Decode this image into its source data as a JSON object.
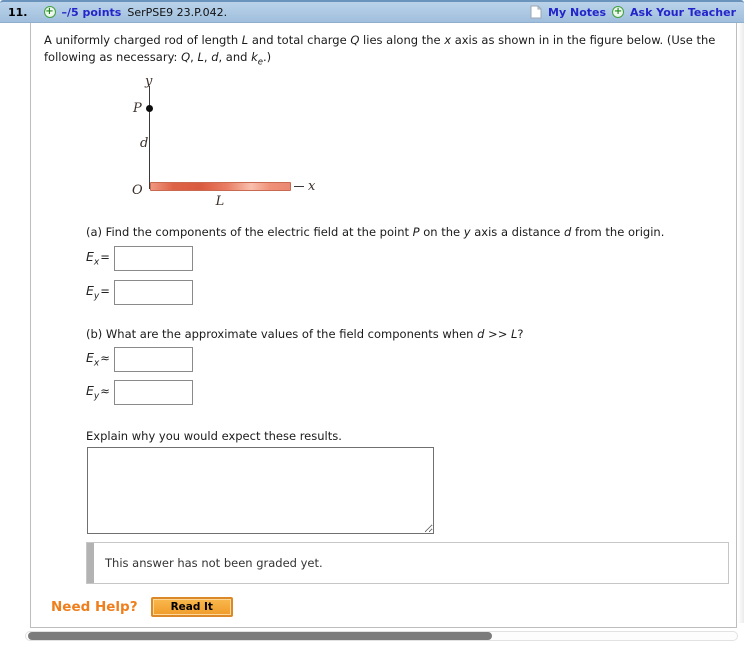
{
  "header": {
    "question_number": "11.",
    "points_label": "–/5 points",
    "assignment_id": "SerPSE9 23.P.042.",
    "my_notes": "My Notes",
    "ask_your_teacher": "Ask Your Teacher",
    "plus_icon_glyph": "+"
  },
  "colors": {
    "header_blue": "#aac6e2",
    "link_blue": "#2424cb",
    "need_help_orange": "#ef7f1d",
    "rod_red": "#dd6347",
    "scroll_thumb_gray": "#7c7c7c"
  },
  "question": {
    "intro": [
      "A uniformly charged rod of length ",
      "L",
      " and total charge ",
      "Q",
      " lies along the ",
      "x",
      " axis as shown in in the figure below. (Use the following as necessary: ",
      "Q",
      ", ",
      "L",
      ", ",
      "d",
      ", and ",
      "k",
      "e",
      ".)"
    ],
    "figure": {
      "labels": {
        "y_axis": "y",
        "point": "P",
        "distance": "d",
        "origin": "O",
        "length": "L",
        "x_axis": "x"
      }
    },
    "part_a": {
      "prompt": [
        "(a) Find the components of the electric field at the point ",
        "P",
        " on the ",
        "y",
        " axis a distance ",
        "d",
        " from the origin."
      ],
      "fields": [
        {
          "base": "E",
          "sub": "x",
          "op": "="
        },
        {
          "base": "E",
          "sub": "y",
          "op": "="
        }
      ]
    },
    "part_b": {
      "prompt": [
        "(b) What are the approximate values of the field components when ",
        "d",
        " >> ",
        "L",
        "?"
      ],
      "fields": [
        {
          "base": "E",
          "sub": "x",
          "op": "≈"
        },
        {
          "base": "E",
          "sub": "y",
          "op": "≈"
        }
      ]
    },
    "explain_prompt": "Explain why you would expect these results."
  },
  "grading": {
    "status": "This answer has not been graded yet."
  },
  "help": {
    "label": "Need Help?",
    "read_it": "Read It"
  }
}
